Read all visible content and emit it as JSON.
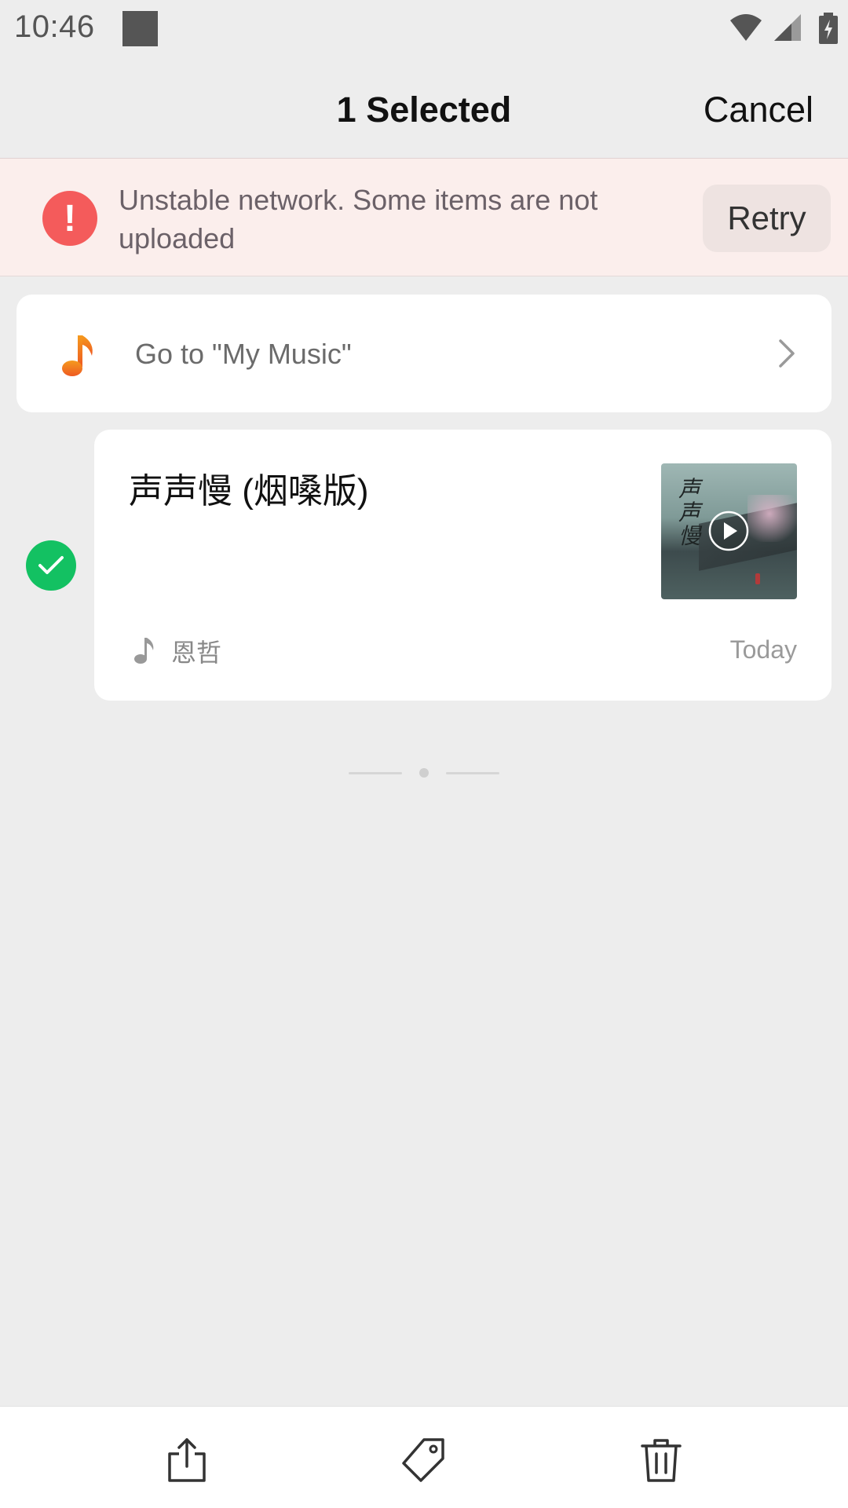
{
  "status_bar": {
    "time": "10:46"
  },
  "header": {
    "title": "1 Selected",
    "cancel_label": "Cancel"
  },
  "error_banner": {
    "message": "Unstable network. Some items are not uploaded",
    "icon": "exclamation",
    "retry_label": "Retry",
    "accent_color": "#f45b5b"
  },
  "music_link": {
    "label": "Go to \"My Music\"",
    "icon": "music-note-icon",
    "icon_color": "#f07a1a"
  },
  "items": [
    {
      "title": "声声慢 (烟嗓版)",
      "artist": "恩哲",
      "date": "Today",
      "selected": true,
      "cover_text": "声声慢"
    }
  ],
  "toolbar": {
    "actions": [
      "share-icon",
      "tag-icon",
      "delete-icon"
    ]
  },
  "colors": {
    "background": "#ededed",
    "selection": "#13c162"
  }
}
